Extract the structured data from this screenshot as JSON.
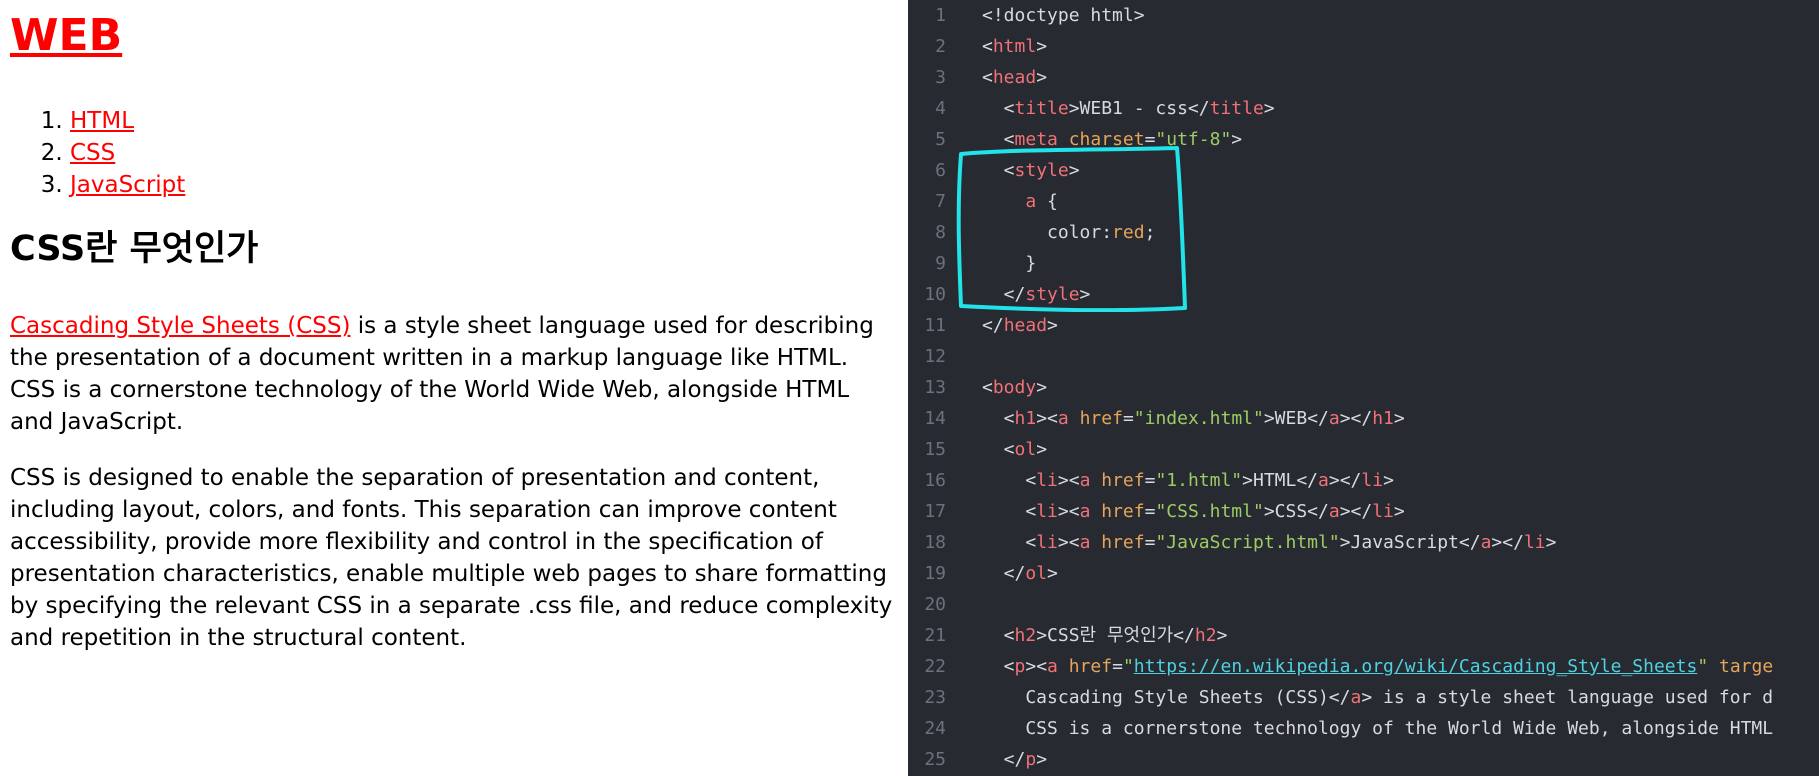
{
  "preview": {
    "h1_link": "WEB",
    "list": [
      "HTML",
      "CSS",
      "JavaScript"
    ],
    "h2": "CSS란 무엇인가",
    "p1_link": "Cascading Style Sheets (CSS)",
    "p1_text": " is a style sheet language used for describing the presentation of a document written in a markup language like HTML. CSS is a cornerstone technology of the World Wide Web, alongside HTML and JavaScript.",
    "p2_text": "CSS is designed to enable the separation of presentation and content, including layout, colors, and fonts. This separation can improve content accessibility, provide more flexibility and control in the specification of presentation characteristics, enable multiple web pages to share formatting by specifying the relevant CSS in a separate .css file, and reduce complexity and repetition in the structural content."
  },
  "editor": {
    "lines": [
      {
        "n": "1",
        "tokens": [
          {
            "t": "tx",
            "v": "<!doctype html>"
          }
        ]
      },
      {
        "n": "2",
        "tokens": [
          {
            "t": "tx",
            "v": "<"
          },
          {
            "t": "tag",
            "v": "html"
          },
          {
            "t": "tx",
            "v": ">"
          }
        ]
      },
      {
        "n": "3",
        "tokens": [
          {
            "t": "tx",
            "v": "<"
          },
          {
            "t": "tag",
            "v": "head"
          },
          {
            "t": "tx",
            "v": ">"
          }
        ]
      },
      {
        "n": "4",
        "tokens": [
          {
            "t": "tx",
            "v": "  <"
          },
          {
            "t": "tag",
            "v": "title"
          },
          {
            "t": "tx",
            "v": ">WEB1 - css</"
          },
          {
            "t": "tag",
            "v": "title"
          },
          {
            "t": "tx",
            "v": ">"
          }
        ]
      },
      {
        "n": "5",
        "tokens": [
          {
            "t": "tx",
            "v": "  <"
          },
          {
            "t": "tag",
            "v": "meta"
          },
          {
            "t": "tx",
            "v": " "
          },
          {
            "t": "attr",
            "v": "charset"
          },
          {
            "t": "tx",
            "v": "="
          },
          {
            "t": "str",
            "v": "\"utf-8\""
          },
          {
            "t": "tx",
            "v": ">"
          }
        ]
      },
      {
        "n": "6",
        "tokens": [
          {
            "t": "tx",
            "v": "  <"
          },
          {
            "t": "tag",
            "v": "style"
          },
          {
            "t": "tx",
            "v": ">"
          }
        ]
      },
      {
        "n": "7",
        "tokens": [
          {
            "t": "tx",
            "v": "    "
          },
          {
            "t": "kw",
            "v": "a"
          },
          {
            "t": "tx",
            "v": " {"
          }
        ]
      },
      {
        "n": "8",
        "tokens": [
          {
            "t": "tx",
            "v": "      color:"
          },
          {
            "t": "val",
            "v": "red"
          },
          {
            "t": "tx",
            "v": ";"
          }
        ]
      },
      {
        "n": "9",
        "tokens": [
          {
            "t": "tx",
            "v": "    }"
          }
        ]
      },
      {
        "n": "10",
        "tokens": [
          {
            "t": "tx",
            "v": "  </"
          },
          {
            "t": "tag",
            "v": "style"
          },
          {
            "t": "tx",
            "v": ">"
          }
        ]
      },
      {
        "n": "11",
        "tokens": [
          {
            "t": "tx",
            "v": "</"
          },
          {
            "t": "tag",
            "v": "head"
          },
          {
            "t": "tx",
            "v": ">"
          }
        ]
      },
      {
        "n": "12",
        "tokens": []
      },
      {
        "n": "13",
        "tokens": [
          {
            "t": "tx",
            "v": "<"
          },
          {
            "t": "tag",
            "v": "body"
          },
          {
            "t": "tx",
            "v": ">"
          }
        ]
      },
      {
        "n": "14",
        "tokens": [
          {
            "t": "tx",
            "v": "  <"
          },
          {
            "t": "tag",
            "v": "h1"
          },
          {
            "t": "tx",
            "v": "><"
          },
          {
            "t": "tag",
            "v": "a"
          },
          {
            "t": "tx",
            "v": " "
          },
          {
            "t": "attr",
            "v": "href"
          },
          {
            "t": "tx",
            "v": "="
          },
          {
            "t": "str",
            "v": "\"index.html\""
          },
          {
            "t": "tx",
            "v": ">WEB</"
          },
          {
            "t": "tag",
            "v": "a"
          },
          {
            "t": "tx",
            "v": "></"
          },
          {
            "t": "tag",
            "v": "h1"
          },
          {
            "t": "tx",
            "v": ">"
          }
        ]
      },
      {
        "n": "15",
        "tokens": [
          {
            "t": "tx",
            "v": "  <"
          },
          {
            "t": "tag",
            "v": "ol"
          },
          {
            "t": "tx",
            "v": ">"
          }
        ]
      },
      {
        "n": "16",
        "tokens": [
          {
            "t": "tx",
            "v": "    <"
          },
          {
            "t": "tag",
            "v": "li"
          },
          {
            "t": "tx",
            "v": "><"
          },
          {
            "t": "tag",
            "v": "a"
          },
          {
            "t": "tx",
            "v": " "
          },
          {
            "t": "attr",
            "v": "href"
          },
          {
            "t": "tx",
            "v": "="
          },
          {
            "t": "str",
            "v": "\"1.html\""
          },
          {
            "t": "tx",
            "v": ">HTML</"
          },
          {
            "t": "tag",
            "v": "a"
          },
          {
            "t": "tx",
            "v": "></"
          },
          {
            "t": "tag",
            "v": "li"
          },
          {
            "t": "tx",
            "v": ">"
          }
        ]
      },
      {
        "n": "17",
        "tokens": [
          {
            "t": "tx",
            "v": "    <"
          },
          {
            "t": "tag",
            "v": "li"
          },
          {
            "t": "tx",
            "v": "><"
          },
          {
            "t": "tag",
            "v": "a"
          },
          {
            "t": "tx",
            "v": " "
          },
          {
            "t": "attr",
            "v": "href"
          },
          {
            "t": "tx",
            "v": "="
          },
          {
            "t": "str",
            "v": "\"CSS.html\""
          },
          {
            "t": "tx",
            "v": ">CSS</"
          },
          {
            "t": "tag",
            "v": "a"
          },
          {
            "t": "tx",
            "v": "></"
          },
          {
            "t": "tag",
            "v": "li"
          },
          {
            "t": "tx",
            "v": ">"
          }
        ]
      },
      {
        "n": "18",
        "tokens": [
          {
            "t": "tx",
            "v": "    <"
          },
          {
            "t": "tag",
            "v": "li"
          },
          {
            "t": "tx",
            "v": "><"
          },
          {
            "t": "tag",
            "v": "a"
          },
          {
            "t": "tx",
            "v": " "
          },
          {
            "t": "attr",
            "v": "href"
          },
          {
            "t": "tx",
            "v": "="
          },
          {
            "t": "str",
            "v": "\"JavaScript.html\""
          },
          {
            "t": "tx",
            "v": ">JavaScript</"
          },
          {
            "t": "tag",
            "v": "a"
          },
          {
            "t": "tx",
            "v": "></"
          },
          {
            "t": "tag",
            "v": "li"
          },
          {
            "t": "tx",
            "v": ">"
          }
        ]
      },
      {
        "n": "19",
        "tokens": [
          {
            "t": "tx",
            "v": "  </"
          },
          {
            "t": "tag",
            "v": "ol"
          },
          {
            "t": "tx",
            "v": ">"
          }
        ]
      },
      {
        "n": "20",
        "tokens": []
      },
      {
        "n": "21",
        "tokens": [
          {
            "t": "tx",
            "v": "  <"
          },
          {
            "t": "tag",
            "v": "h2"
          },
          {
            "t": "tx",
            "v": ">CSS란 무엇인가</"
          },
          {
            "t": "tag",
            "v": "h2"
          },
          {
            "t": "tx",
            "v": ">"
          }
        ]
      },
      {
        "n": "22",
        "tokens": [
          {
            "t": "tx",
            "v": "  <"
          },
          {
            "t": "tag",
            "v": "p"
          },
          {
            "t": "tx",
            "v": "><"
          },
          {
            "t": "tag",
            "v": "a"
          },
          {
            "t": "tx",
            "v": " "
          },
          {
            "t": "attr",
            "v": "href"
          },
          {
            "t": "tx",
            "v": "="
          },
          {
            "t": "str",
            "v": "\""
          },
          {
            "t": "url",
            "v": "https://en.wikipedia.org/wiki/Cascading_Style_Sheets"
          },
          {
            "t": "str",
            "v": "\""
          },
          {
            "t": "tx",
            "v": " "
          },
          {
            "t": "attr",
            "v": "targe"
          }
        ]
      },
      {
        "n": "23",
        "tokens": [
          {
            "t": "tx",
            "v": "    Cascading Style Sheets (CSS)</"
          },
          {
            "t": "tag",
            "v": "a"
          },
          {
            "t": "tx",
            "v": "> is a style sheet language used for d"
          }
        ]
      },
      {
        "n": "24",
        "tokens": [
          {
            "t": "tx",
            "v": "    CSS is a cornerstone technology of the World Wide Web, alongside HTML"
          }
        ]
      },
      {
        "n": "25",
        "tokens": [
          {
            "t": "tx",
            "v": "  </"
          },
          {
            "t": "tag",
            "v": "p"
          },
          {
            "t": "tx",
            "v": ">"
          }
        ]
      }
    ]
  },
  "colors": {
    "link": "#ff0000",
    "editor_bg": "#272a30",
    "highlight": "#22e3ea"
  }
}
